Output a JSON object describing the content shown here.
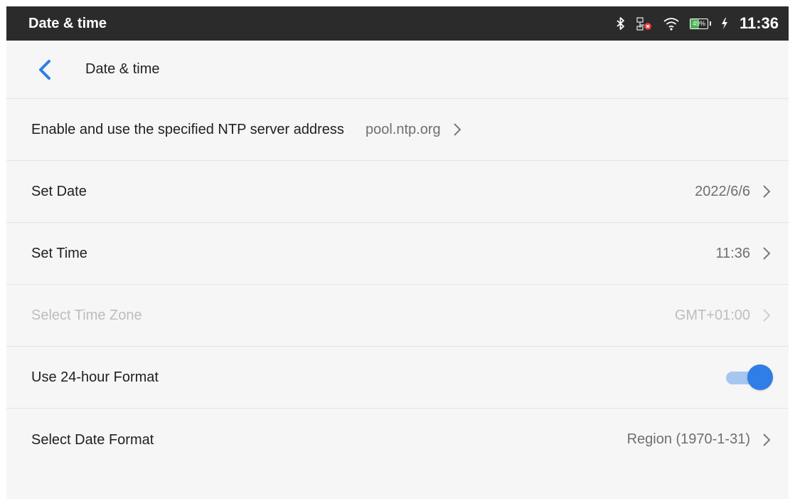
{
  "statusbar": {
    "title": "Date & time",
    "time": "11:36",
    "battery_text": "49%",
    "battery_level": 0.49,
    "icons": [
      "bluetooth-icon",
      "ethernet-disconnected-icon",
      "wifi-icon",
      "battery-icon",
      "charging-icon"
    ]
  },
  "header": {
    "title": "Date & time",
    "back_icon": "back-arrow-icon"
  },
  "rows": {
    "ntp": {
      "label": "Enable and use the specified NTP server address",
      "value": "pool.ntp.org"
    },
    "set_date": {
      "label": "Set Date",
      "value": "2022/6/6"
    },
    "set_time": {
      "label": "Set Time",
      "value": "11:36"
    },
    "time_zone": {
      "label": "Select Time Zone",
      "value": "GMT+01:00",
      "disabled": true
    },
    "hour24": {
      "label": "Use 24-hour Format",
      "toggle_on": true
    },
    "date_format": {
      "label": "Select Date Format",
      "value": "Region (1970-1-31)"
    }
  },
  "colors": {
    "accent": "#2f7de6",
    "accent_light": "#a6c6f0",
    "statusbar_bg": "#2b2b2b",
    "page_bg": "#f6f6f6",
    "battery_fill": "#4caf50",
    "disabled_text": "#bdbdbd"
  }
}
